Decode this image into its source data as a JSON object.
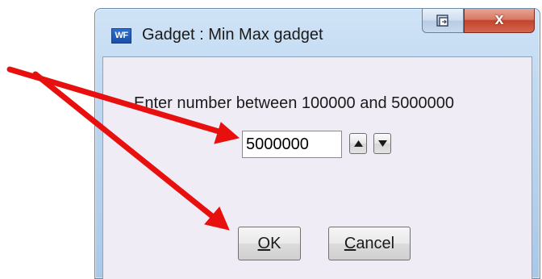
{
  "window": {
    "app_icon_text": "WF",
    "title": "Gadget : Min Max gadget",
    "close_glyph": "x",
    "restore_icon": "restore-icon"
  },
  "dialog": {
    "prompt": "Enter number between 100000 and 5000000",
    "input_value": "5000000",
    "spin_up_icon": "triangle-up-icon",
    "spin_down_icon": "triangle-down-icon",
    "ok_button": {
      "mnemonic": "O",
      "rest": "K"
    },
    "cancel_button": {
      "mnemonic": "C",
      "rest": "ancel"
    }
  },
  "annotation": {
    "arrow_color": "#e8100e"
  }
}
